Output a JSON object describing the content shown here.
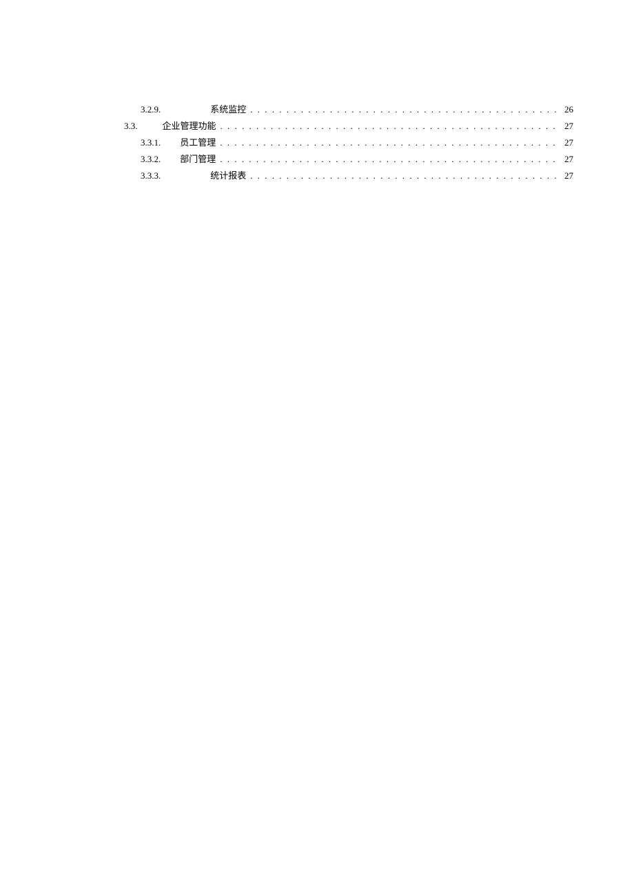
{
  "toc": {
    "entries": [
      {
        "level": 3,
        "gap": "wide",
        "number": "3.2.9.",
        "title": "系统监控",
        "page": "26"
      },
      {
        "level": 2,
        "gap": "med",
        "number": "3.3.",
        "title": "企业管理功能",
        "page": "27"
      },
      {
        "level": 3,
        "gap": "narrow",
        "number": "3.3.1.",
        "title": "员工管理",
        "page": "27"
      },
      {
        "level": 3,
        "gap": "narrow",
        "number": "3.3.2.",
        "title": "部门管理",
        "page": "27"
      },
      {
        "level": 3,
        "gap": "wide",
        "number": "3.3.3.",
        "title": "统计报表",
        "page": "27"
      }
    ]
  }
}
